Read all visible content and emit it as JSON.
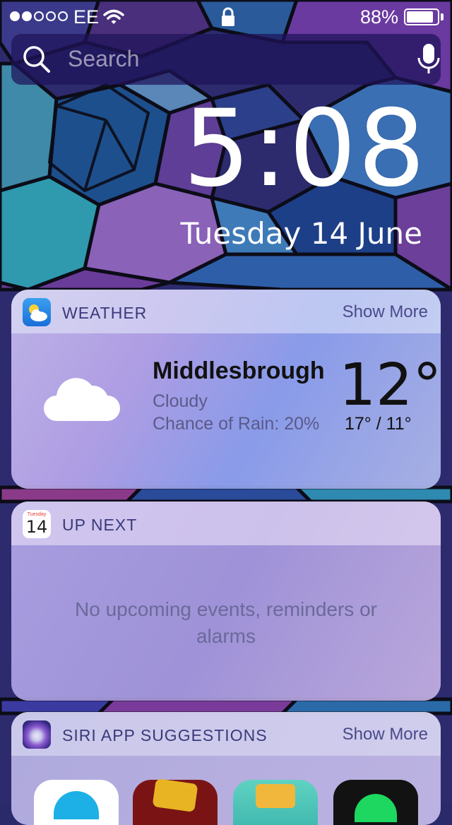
{
  "status_bar": {
    "signal_filled": 2,
    "signal_total": 5,
    "carrier": "EE",
    "battery_percent_label": "88%",
    "battery_level": 0.88
  },
  "search": {
    "placeholder": "Search"
  },
  "lockscreen": {
    "time": "5:08",
    "date": "Tuesday 14 June"
  },
  "weather_widget": {
    "title": "WEATHER",
    "show_more": "Show More",
    "city": "Middlesbrough",
    "condition": "Cloudy",
    "rain_chance": "Chance of Rain: 20%",
    "temperature": "12°",
    "high_low": "17° / 11°"
  },
  "upnext_widget": {
    "title": "UP NEXT",
    "calendar_day": "Tuesday",
    "calendar_date": "14",
    "empty_message": "No upcoming events, reminders or alarms"
  },
  "siri_widget": {
    "title": "SIRI APP SUGGESTIONS",
    "show_more": "Show More",
    "apps": [
      "messenger-app-icon",
      "clash-of-clans-app-icon",
      "clash-royale-app-icon",
      "spotify-app-icon"
    ]
  },
  "colors": {
    "accent_text": "#3a3a7a",
    "weather_title_text": "#111111"
  }
}
